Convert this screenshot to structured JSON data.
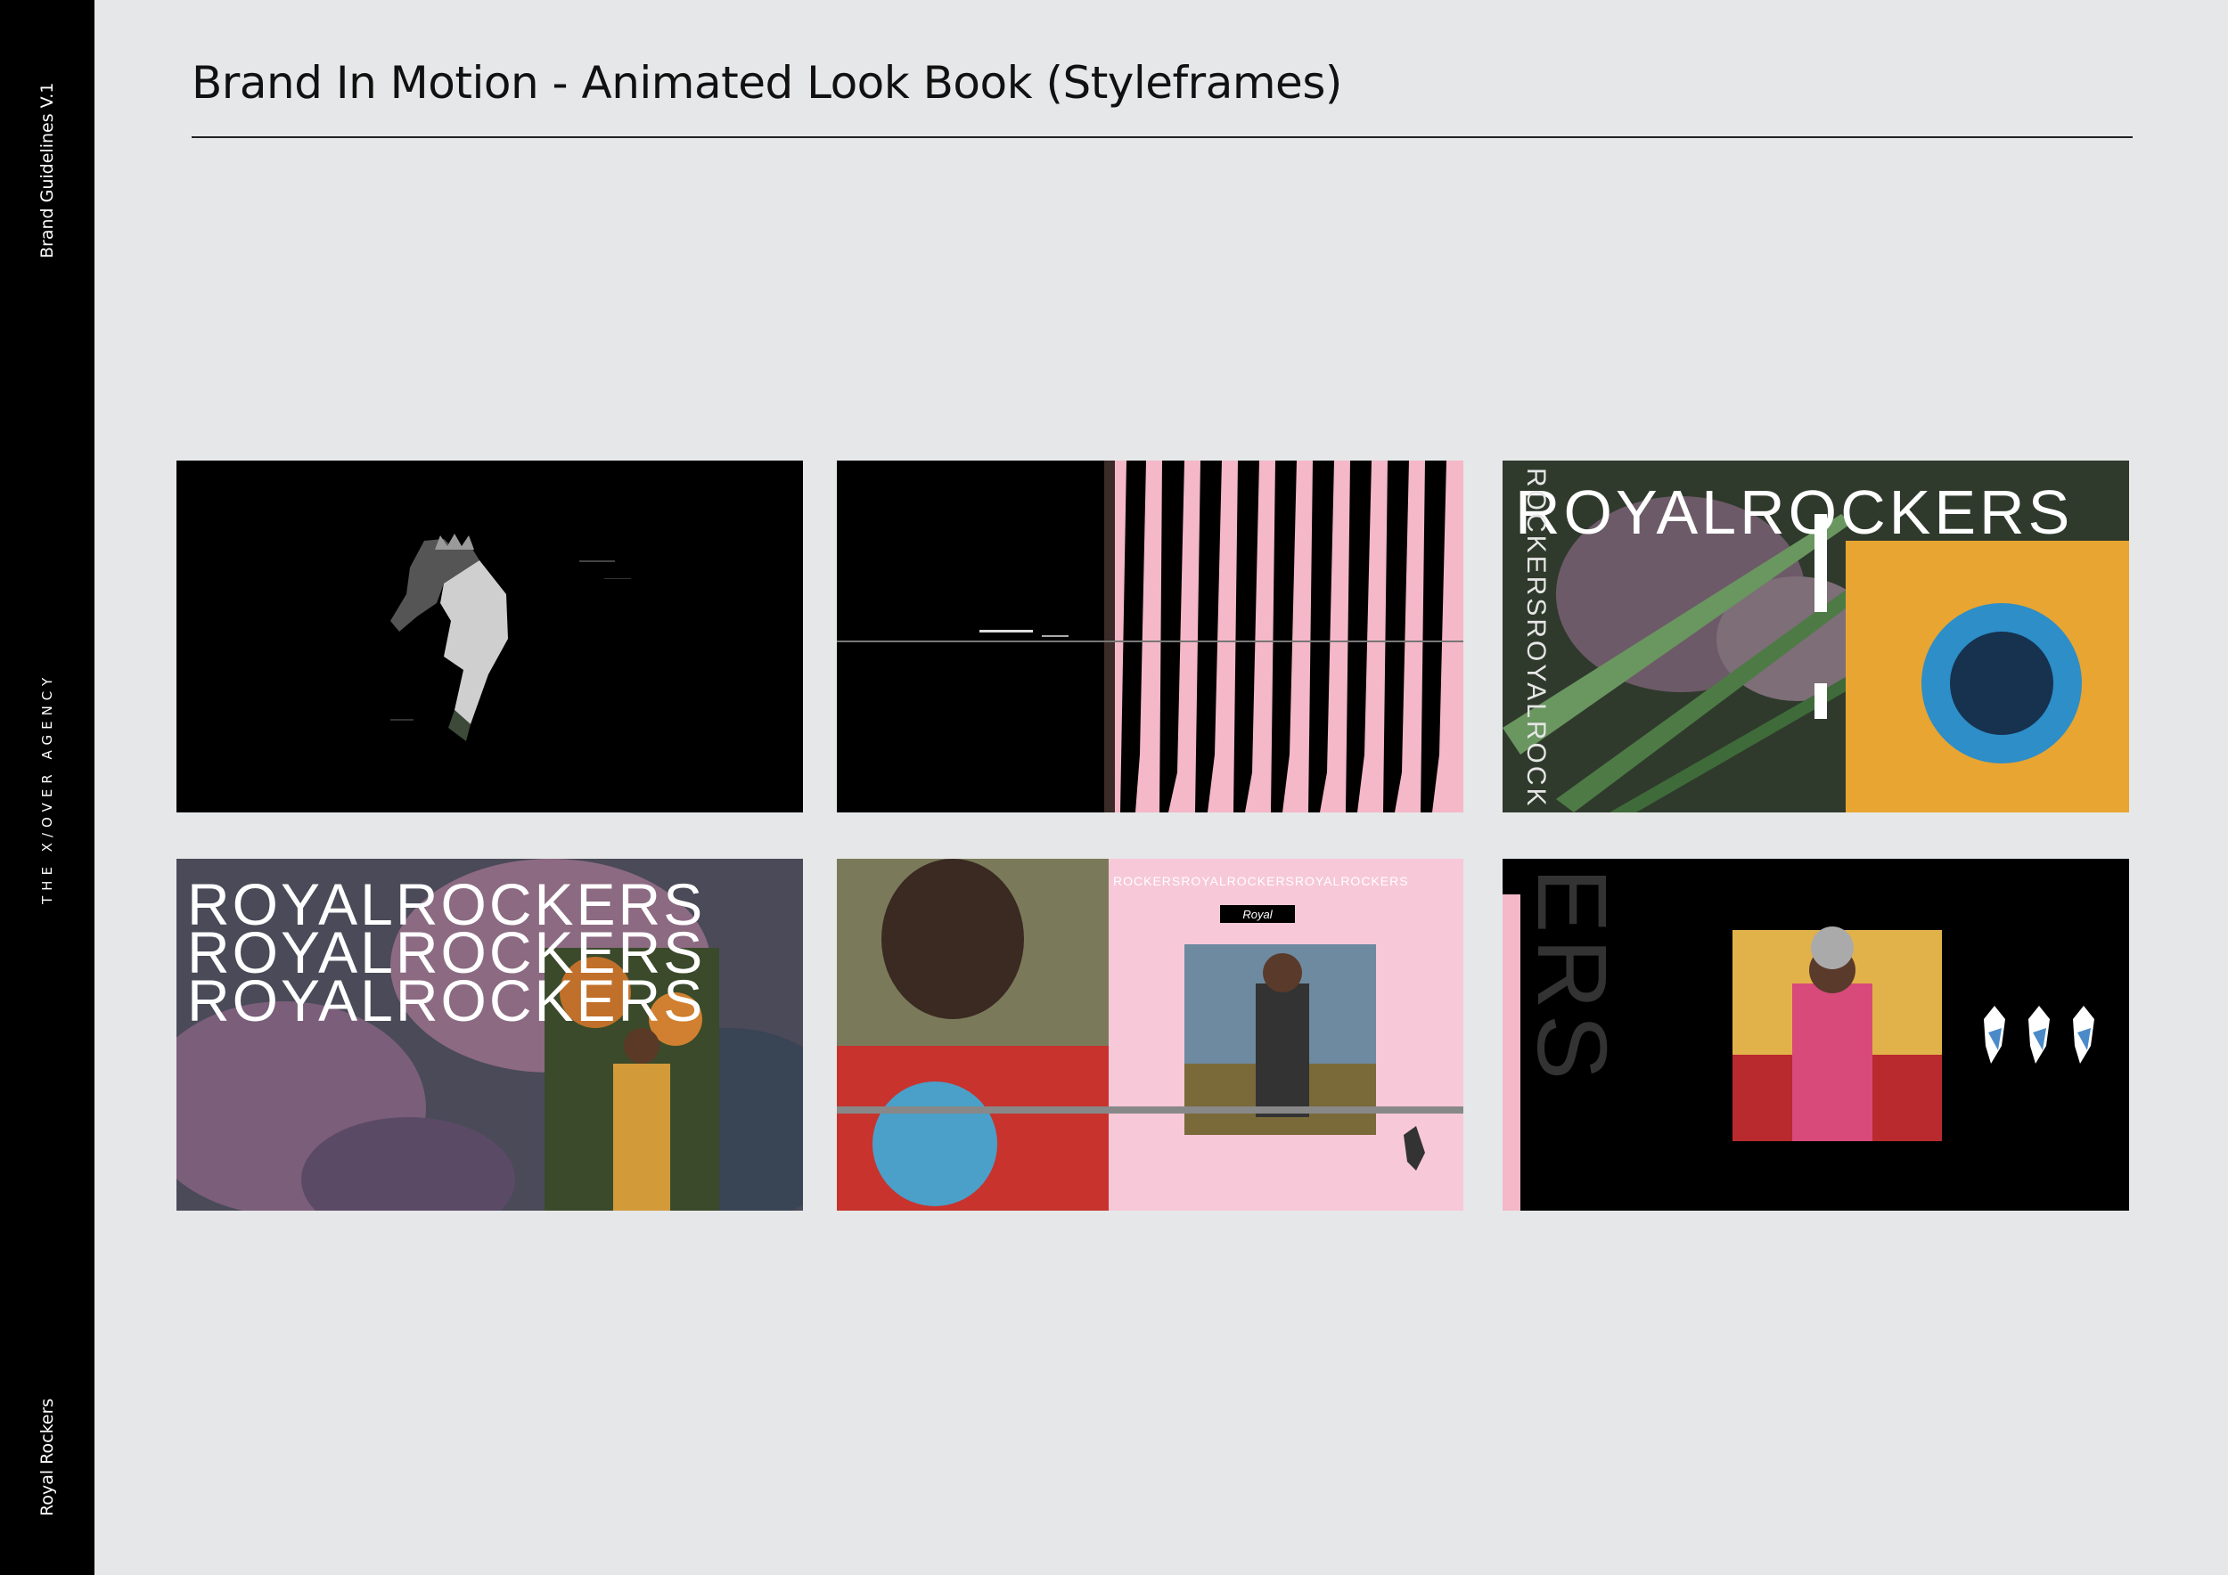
{
  "sidebar": {
    "top_label": "Brand Guidelines V.1",
    "middle_label": "THE X/OVER AGENCY",
    "bottom_label": "Royal Rockers"
  },
  "page": {
    "title": "Brand In Motion - Animated Look Book (Styleframes)"
  },
  "styleframes": {
    "frame3": {
      "wordmark": "ROYALROCKERS",
      "vertical": "ROCKERSROYALROCK"
    },
    "frame4": {
      "line1": "ROYALROCKERS",
      "line2": "ROYALROCKERS",
      "line3": "ROYALROCKERS"
    },
    "frame5": {
      "tag": "Royal",
      "pattern": "ROCKERSROYALROCKERSROYALROCKERS"
    },
    "frame6": {
      "vertical": "ERS"
    }
  },
  "colors": {
    "background": "#e6e7e8",
    "sidebar": "#000000",
    "pink": "#f4b8c8",
    "yellow": "#f2b43a"
  }
}
